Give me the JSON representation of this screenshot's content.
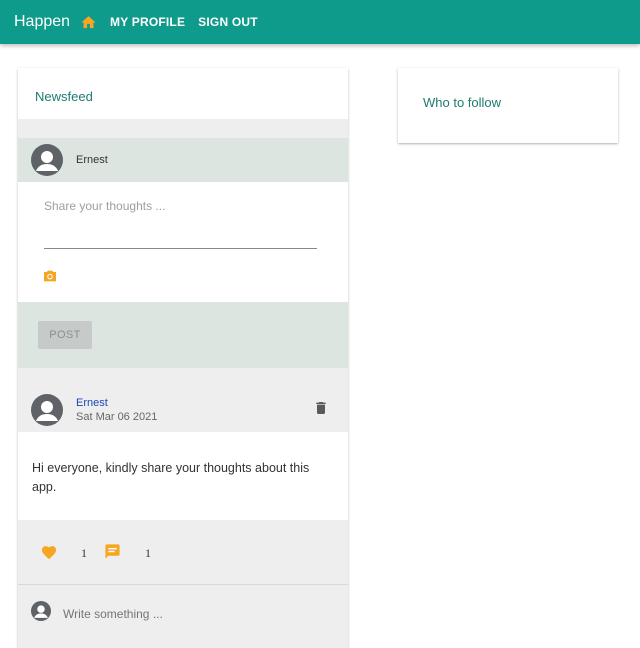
{
  "app": {
    "title": "Happen"
  },
  "nav": {
    "profile_label": "MY PROFILE",
    "signout_label": "SIGN OUT"
  },
  "colors": {
    "primary": "#0f9b8c",
    "accent": "#f6a623",
    "heading": "#1f7a70",
    "link": "#1a47b8"
  },
  "newsfeed": {
    "title": "Newsfeed",
    "new_post": {
      "user_name": "Ernest",
      "placeholder": "Share your thoughts ...",
      "post_label": "POST",
      "photo_icon": "camera-icon"
    },
    "posts": [
      {
        "user_name": "Ernest",
        "date": "Sat Mar 06 2021",
        "text": "Hi everyone, kindly share your thoughts about this app.",
        "likes": "1",
        "comments": "1",
        "comment_placeholder": "Write something ..."
      }
    ]
  },
  "who_to_follow": {
    "title": "Who to follow"
  }
}
